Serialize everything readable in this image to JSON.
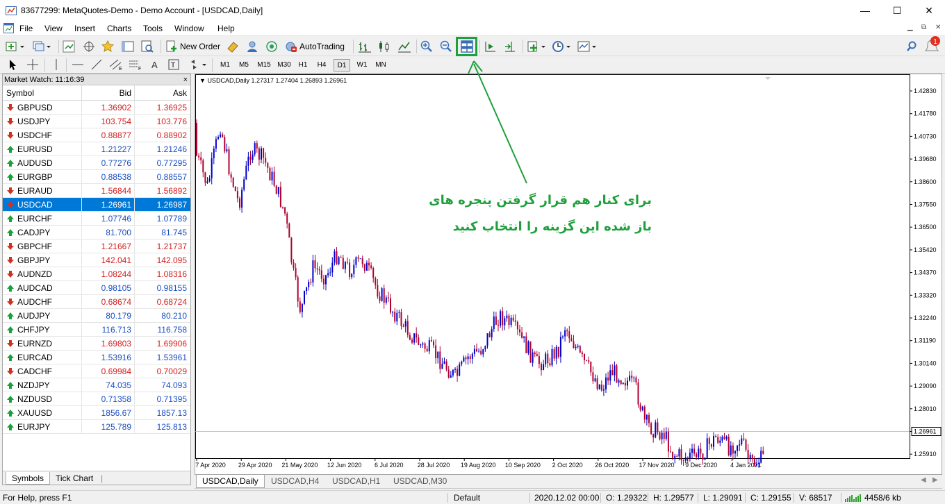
{
  "window": {
    "title": "83677299: MetaQuotes-Demo - Demo Account - [USDCAD,Daily]",
    "minimize": "—",
    "maximize": "☐",
    "close": "✕"
  },
  "menu": [
    "File",
    "View",
    "Insert",
    "Charts",
    "Tools",
    "Window",
    "Help"
  ],
  "mdi_controls": [
    "▁",
    "⧉",
    "✕"
  ],
  "toolbar": {
    "new_order": "New Order",
    "auto_trading": "AutoTrading"
  },
  "timeframes": [
    "M1",
    "M5",
    "M15",
    "M30",
    "H1",
    "H4",
    "D1",
    "W1",
    "MN"
  ],
  "active_timeframe": "D1",
  "market_watch": {
    "title": "Market Watch: 11:16:39",
    "close": "×",
    "columns": {
      "symbol": "Symbol",
      "bid": "Bid",
      "ask": "Ask"
    },
    "rows": [
      {
        "symbol": "GBPUSD",
        "bid": "1.36902",
        "ask": "1.36925",
        "dir": "down"
      },
      {
        "symbol": "USDJPY",
        "bid": "103.754",
        "ask": "103.776",
        "dir": "down"
      },
      {
        "symbol": "USDCHF",
        "bid": "0.88877",
        "ask": "0.88902",
        "dir": "down"
      },
      {
        "symbol": "EURUSD",
        "bid": "1.21227",
        "ask": "1.21246",
        "dir": "up"
      },
      {
        "symbol": "AUDUSD",
        "bid": "0.77276",
        "ask": "0.77295",
        "dir": "up"
      },
      {
        "symbol": "EURGBP",
        "bid": "0.88538",
        "ask": "0.88557",
        "dir": "up"
      },
      {
        "symbol": "EURAUD",
        "bid": "1.56844",
        "ask": "1.56892",
        "dir": "down"
      },
      {
        "symbol": "USDCAD",
        "bid": "1.26961",
        "ask": "1.26987",
        "dir": "down",
        "selected": true
      },
      {
        "symbol": "EURCHF",
        "bid": "1.07746",
        "ask": "1.07789",
        "dir": "up"
      },
      {
        "symbol": "CADJPY",
        "bid": "81.700",
        "ask": "81.745",
        "dir": "up"
      },
      {
        "symbol": "GBPCHF",
        "bid": "1.21667",
        "ask": "1.21737",
        "dir": "down"
      },
      {
        "symbol": "GBPJPY",
        "bid": "142.041",
        "ask": "142.095",
        "dir": "down"
      },
      {
        "symbol": "AUDNZD",
        "bid": "1.08244",
        "ask": "1.08316",
        "dir": "down"
      },
      {
        "symbol": "AUDCAD",
        "bid": "0.98105",
        "ask": "0.98155",
        "dir": "up"
      },
      {
        "symbol": "AUDCHF",
        "bid": "0.68674",
        "ask": "0.68724",
        "dir": "down"
      },
      {
        "symbol": "AUDJPY",
        "bid": "80.179",
        "ask": "80.210",
        "dir": "up"
      },
      {
        "symbol": "CHFJPY",
        "bid": "116.713",
        "ask": "116.758",
        "dir": "up"
      },
      {
        "symbol": "EURNZD",
        "bid": "1.69803",
        "ask": "1.69906",
        "dir": "down"
      },
      {
        "symbol": "EURCAD",
        "bid": "1.53916",
        "ask": "1.53961",
        "dir": "up"
      },
      {
        "symbol": "CADCHF",
        "bid": "0.69984",
        "ask": "0.70029",
        "dir": "down"
      },
      {
        "symbol": "NZDJPY",
        "bid": "74.035",
        "ask": "74.093",
        "dir": "up"
      },
      {
        "symbol": "NZDUSD",
        "bid": "0.71358",
        "ask": "0.71395",
        "dir": "up"
      },
      {
        "symbol": "XAUUSD",
        "bid": "1856.67",
        "ask": "1857.13",
        "dir": "up"
      },
      {
        "symbol": "EURJPY",
        "bid": "125.789",
        "ask": "125.813",
        "dir": "up"
      }
    ],
    "tabs": [
      "Symbols",
      "Tick Chart"
    ]
  },
  "chart": {
    "header": "USDCAD,Daily  1.27317 1.27404 1.26893 1.26961",
    "price_labels": [
      "1.42830",
      "1.41780",
      "1.40730",
      "1.39680",
      "1.38600",
      "1.37550",
      "1.36500",
      "1.35420",
      "1.34370",
      "1.33320",
      "1.32240",
      "1.31190",
      "1.30140",
      "1.29090",
      "1.28010",
      "1.26961",
      "1.25910"
    ],
    "current_price": "1.26961",
    "date_labels": [
      "7 Apr 2020",
      "29 Apr 2020",
      "21 May 2020",
      "12 Jun 2020",
      "6 Jul 2020",
      "28 Jul 2020",
      "19 Aug 2020",
      "10 Sep 2020",
      "2 Oct 2020",
      "26 Oct 2020",
      "17 Nov 2020",
      "9 Dec 2020",
      "4 Jan 2021"
    ],
    "up_color": "#0000cc",
    "down_color": "#b00030",
    "tabs": [
      "USDCAD,Daily",
      "USDCAD,H4",
      "USDCAD,H1",
      "USDCAD,M30"
    ],
    "active_tab": "USDCAD,Daily"
  },
  "annotation": {
    "line1": "برای کنار هم قرار گرفتن پنجره های",
    "line2": "باز شده این گزینه را انتخاب کنید",
    "color": "#1ea03c"
  },
  "status": {
    "help": "For Help, press F1",
    "profile": "Default",
    "datetime": "2020.12.02 00:00",
    "open": "O: 1.29322",
    "high": "H: 1.29577",
    "low": "L: 1.29091",
    "close": "C: 1.29155",
    "volume": "V: 68517",
    "traffic": "4458/6 kb"
  },
  "icons": {
    "app": "metatrader-icon",
    "tile": "tile-windows-icon",
    "search": "search-icon",
    "notify": "notification-icon"
  }
}
